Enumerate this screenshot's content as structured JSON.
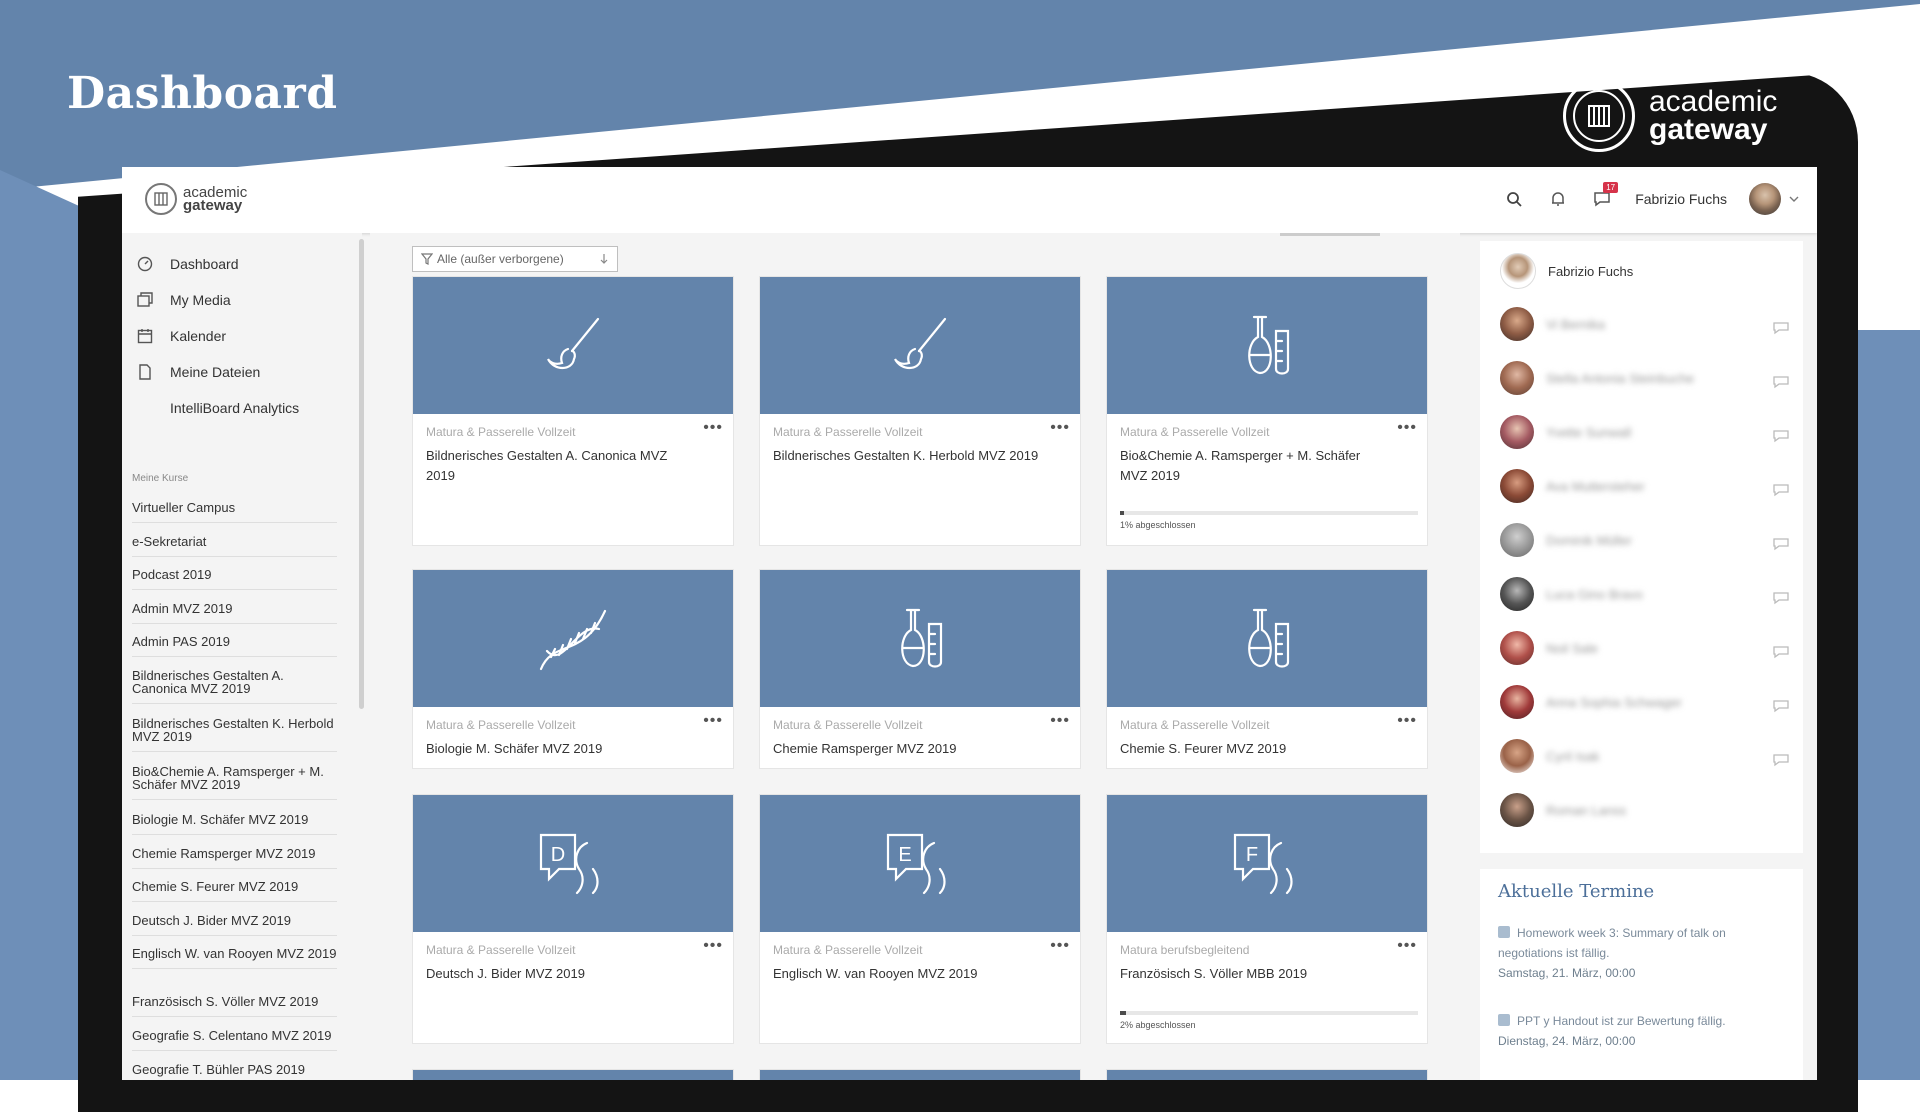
{
  "slide": {
    "title": "Dashboard"
  },
  "brand": {
    "line1": "academic",
    "line2": "gateway"
  },
  "topbar": {
    "user_name": "Fabrizio Fuchs",
    "notification_count": "17",
    "icons": [
      "search-icon",
      "bell-icon",
      "chat-icon",
      "chevron-down-icon"
    ]
  },
  "nav": {
    "items": [
      {
        "label": "Dashboard",
        "icon": "dashboard-icon"
      },
      {
        "label": "My Media",
        "icon": "media-icon"
      },
      {
        "label": "Kalender",
        "icon": "calendar-icon"
      },
      {
        "label": "Meine Dateien",
        "icon": "files-icon"
      },
      {
        "label": "IntelliBoard Analytics",
        "icon": ""
      }
    ],
    "section_label": "Meine Kurse",
    "courses": [
      "Virtueller Campus",
      "e-Sekretariat",
      "Podcast 2019",
      "Admin MVZ 2019",
      "Admin PAS 2019",
      "Bildnerisches Gestalten A. Canonica MVZ 2019",
      "Bildnerisches Gestalten K. Herbold MVZ 2019",
      "Bio&Chemie A. Ramsperger + M. Schäfer MVZ 2019",
      "Biologie M. Schäfer MVZ 2019",
      "Chemie Ramsperger MVZ 2019",
      "Chemie S. Feurer MVZ 2019",
      "Deutsch J. Bider MVZ 2019",
      "Englisch W. van Rooyen MVZ 2019",
      "Französisch S. Völler MVZ 2019",
      "Geografie S. Celentano MVZ 2019",
      "Geografie T. Bühler PAS 2019"
    ]
  },
  "filter": {
    "label": "Alle (außer verborgene)"
  },
  "courses": [
    {
      "category": "Matura & Passerelle Vollzeit",
      "name": "Bildnerisches Gestalten A. Canonica MVZ 2019",
      "icon": "brush-icon"
    },
    {
      "category": "Matura & Passerelle Vollzeit",
      "name": "Bildnerisches Gestalten K. Herbold MVZ 2019",
      "icon": "brush-icon"
    },
    {
      "category": "Matura & Passerelle Vollzeit",
      "name": "Bio&Chemie A. Ramsperger + M. Schäfer MVZ 2019",
      "icon": "flask-icon",
      "progress": 0.01,
      "progress_text": "1% abgeschlossen"
    },
    {
      "category": "Matura & Passerelle Vollzeit",
      "name": "Biologie M. Schäfer MVZ 2019",
      "icon": "dna-icon"
    },
    {
      "category": "Matura & Passerelle Vollzeit",
      "name": "Chemie Ramsperger MVZ 2019",
      "icon": "flask-icon"
    },
    {
      "category": "Matura & Passerelle Vollzeit",
      "name": "Chemie S. Feurer MVZ 2019",
      "icon": "flask-icon"
    },
    {
      "category": "Matura & Passerelle Vollzeit",
      "name": "Deutsch J. Bider MVZ 2019",
      "icon": "speech-icon",
      "letter": "D"
    },
    {
      "category": "Matura & Passerelle Vollzeit",
      "name": "Englisch W. van Rooyen MVZ 2019",
      "icon": "speech-icon",
      "letter": "E"
    },
    {
      "category": "Matura berufsbegleitend",
      "name": "Französisch S. Völler MBB 2019",
      "icon": "speech-icon",
      "letter": "F",
      "progress": 0.02,
      "progress_text": "2% abgeschlossen"
    }
  ],
  "contacts": {
    "self": "Fabrizio Fuchs",
    "others": [
      "Vi Bernika",
      "Stella Antonia Steinbuche",
      "Yvette Sunwall",
      "Ava Muttersteher",
      "Dominik Müller",
      "Luca Gino Bravo",
      "Noil Sale",
      "Anna Sophia Schwager",
      "Cyril Isak",
      "Roman Lanss"
    ]
  },
  "termine": {
    "title": "Aktuelle Termine",
    "events": [
      {
        "text": "Homework week 3: Summary of talk on negotiations ist fällig.",
        "when": "Samstag, 21. März, 00:00"
      },
      {
        "text": "PPT y Handout ist zur Bewertung fällig.",
        "when": "Dienstag, 24. März, 00:00"
      }
    ]
  },
  "colors": {
    "tile": "#6384ab",
    "accent_title": "#4c6f99",
    "badge": "#d6334a"
  }
}
